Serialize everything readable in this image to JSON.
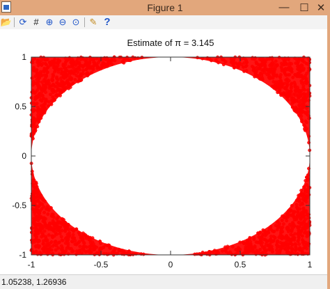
{
  "window": {
    "title": "Figure 1",
    "minimize_symbol": "—",
    "maximize_symbol": "☐",
    "close_symbol": "✕"
  },
  "toolbar": {
    "tools": [
      {
        "name": "open-figure-icon",
        "glyph": "📂",
        "color": "#c98a1c"
      },
      {
        "name": "refresh-icon",
        "glyph": "⟳",
        "color": "#1f55c8"
      },
      {
        "name": "grid-icon",
        "glyph": "#",
        "color": "#222222"
      },
      {
        "name": "zoom-in-icon",
        "glyph": "⊕",
        "color": "#1f55c8"
      },
      {
        "name": "zoom-out-icon",
        "glyph": "⊖",
        "color": "#1f55c8"
      },
      {
        "name": "zoom-fit-icon",
        "glyph": "⊙",
        "color": "#1f55c8"
      },
      {
        "name": "settings-wrench-icon",
        "glyph": "✎",
        "color": "#c28a20"
      },
      {
        "name": "help-icon",
        "glyph": "?",
        "color": "#1f55c8"
      }
    ]
  },
  "status": {
    "coordinates": "1.05238,  1.26936"
  },
  "colors": {
    "points": "#ff0000",
    "titlebar": "#e2a77c"
  },
  "chart_data": {
    "type": "scatter",
    "title": "Estimate of π = 3.145",
    "xlabel": "",
    "ylabel": "",
    "xlim": [
      -1,
      1
    ],
    "ylim": [
      -1,
      1
    ],
    "x_ticks": [
      "-1",
      "-0.5",
      "0",
      "0.5",
      "1"
    ],
    "y_ticks": [
      "1",
      "0.5",
      "0",
      "-0.5",
      "-1"
    ],
    "grid": false,
    "series": [
      {
        "description_of_points": "uniform random points in [-1,1]x[-1,1] lying outside the unit circle x^2+y^2>1",
        "color": "#ff0000",
        "marker": "circle"
      }
    ]
  }
}
